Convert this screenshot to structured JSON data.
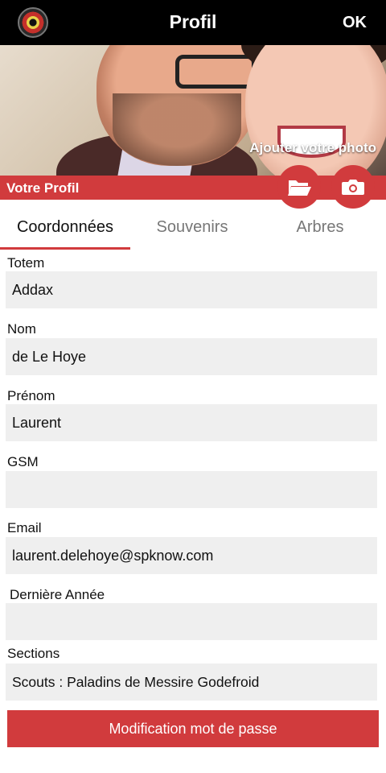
{
  "header": {
    "title": "Profil",
    "ok_label": "OK",
    "logo_icon": "scout-emblem-icon"
  },
  "photo": {
    "add_photo_label": "Ajouter votre photo"
  },
  "profile_bar": {
    "label": "Votre Profil",
    "folder_icon": "folder-open-icon",
    "camera_icon": "camera-icon",
    "accent_color": "#d13b3d"
  },
  "tabs": [
    {
      "label": "Coordonnées",
      "active": true
    },
    {
      "label": "Souvenirs",
      "active": false
    },
    {
      "label": "Arbres",
      "active": false
    }
  ],
  "fields": {
    "totem": {
      "label": "Totem",
      "value": "Addax"
    },
    "nom": {
      "label": "Nom",
      "value": "de Le Hoye"
    },
    "prenom": {
      "label": "Prénom",
      "value": "Laurent"
    },
    "gsm": {
      "label": "GSM",
      "value": ""
    },
    "email": {
      "label": "Email",
      "value": "laurent.delehoye@spknow.com"
    },
    "derniere_annee": {
      "label": "Dernière Année",
      "value": ""
    },
    "sections": {
      "label": "Sections",
      "value": "Scouts : Paladins de Messire Godefroid"
    }
  },
  "password_button": {
    "label": "Modification mot de passe"
  }
}
